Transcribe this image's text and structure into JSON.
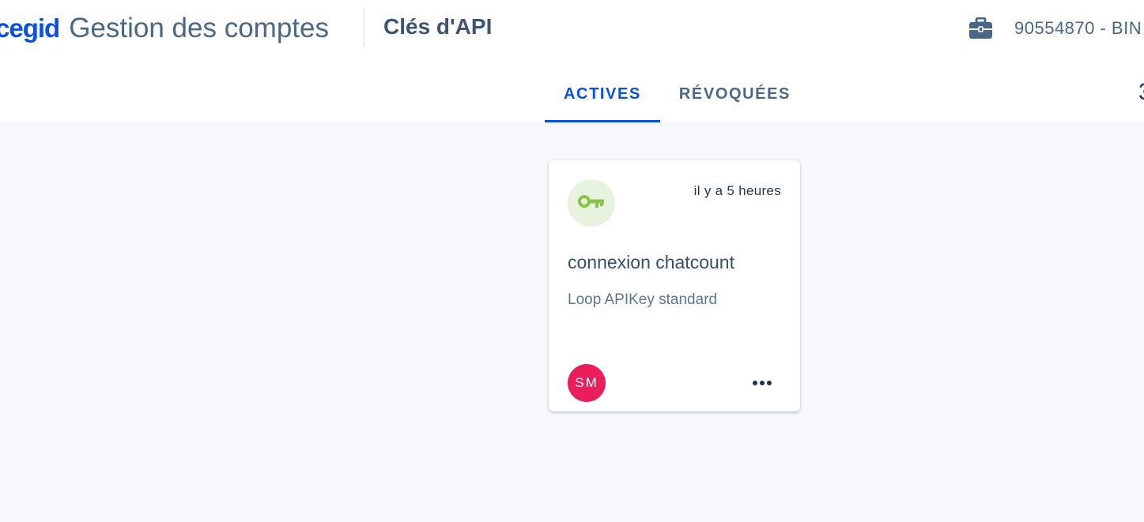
{
  "header": {
    "brand_logo": "cegid",
    "app_title": "Gestion des comptes",
    "page_title": "Clés d'API",
    "account_label": "90554870 - BIN",
    "right_clipped_char": "3"
  },
  "tabs": [
    {
      "label": "ACTIVES",
      "active": true
    },
    {
      "label": "RÉVOQUÉES",
      "active": false
    }
  ],
  "cards": [
    {
      "icon": "key-icon",
      "timestamp": "il y a 5 heures",
      "name": "connexion chatcount",
      "type": "Loop APIKey standard",
      "avatar_initials": "SM",
      "menu_icon": "more-horizontal-icon"
    }
  ],
  "colors": {
    "brand_blue": "#0a4fe0",
    "avatar_pink": "#e91e5a",
    "key_green": "#8bc34a",
    "key_badge_bg": "#e8f3df",
    "page_bg": "#f6f8fc"
  }
}
